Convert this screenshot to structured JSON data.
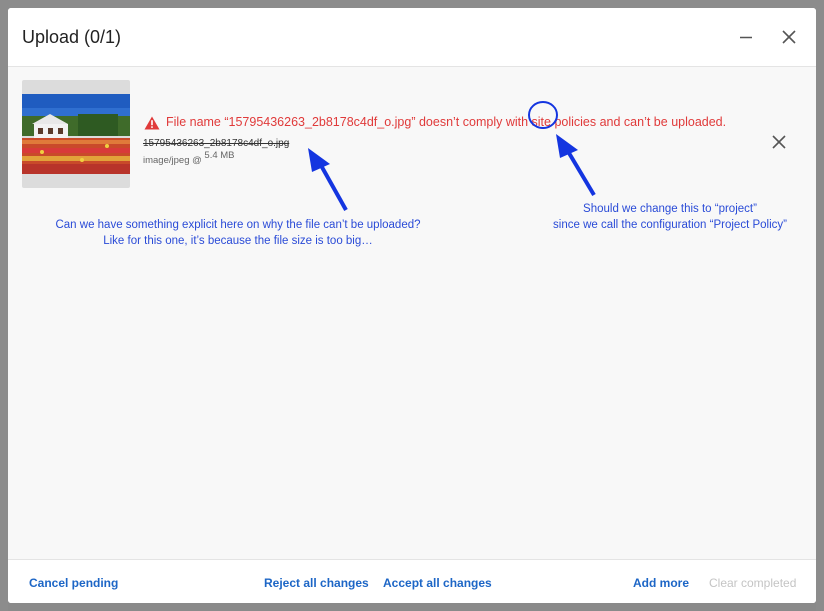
{
  "dialog": {
    "title": "Upload (0/1)"
  },
  "file": {
    "error_message": "File name “15795436263_2b8178c4df_o.jpg” doesn’t comply with site policies and can’t be uploaded.",
    "name": "15795436263_2b8178c4df_o.jpg",
    "type": "image/jpeg @",
    "size": "5.4 MB",
    "thumbnail_icon": "tulip-field-thumbnail"
  },
  "annotations": {
    "note_1_line_1": "Can we have something explicit here on why the file can’t be uploaded?",
    "note_1_line_2": "Like for this one, it’s because the file size is too big…",
    "note_2_line_1": "Should we change this to “project”",
    "note_2_line_2": "since we call the configuration “Project Policy”"
  },
  "footer": {
    "cancel_pending": "Cancel pending",
    "reject_all": "Reject all changes",
    "accept_all": "Accept all changes",
    "add_more": "Add more",
    "clear_completed": "Clear completed"
  },
  "colors": {
    "error": "#e03a3a",
    "link": "#1d66c6",
    "annotation": "#2a4bd7",
    "disabled": "#c4c4c4"
  }
}
